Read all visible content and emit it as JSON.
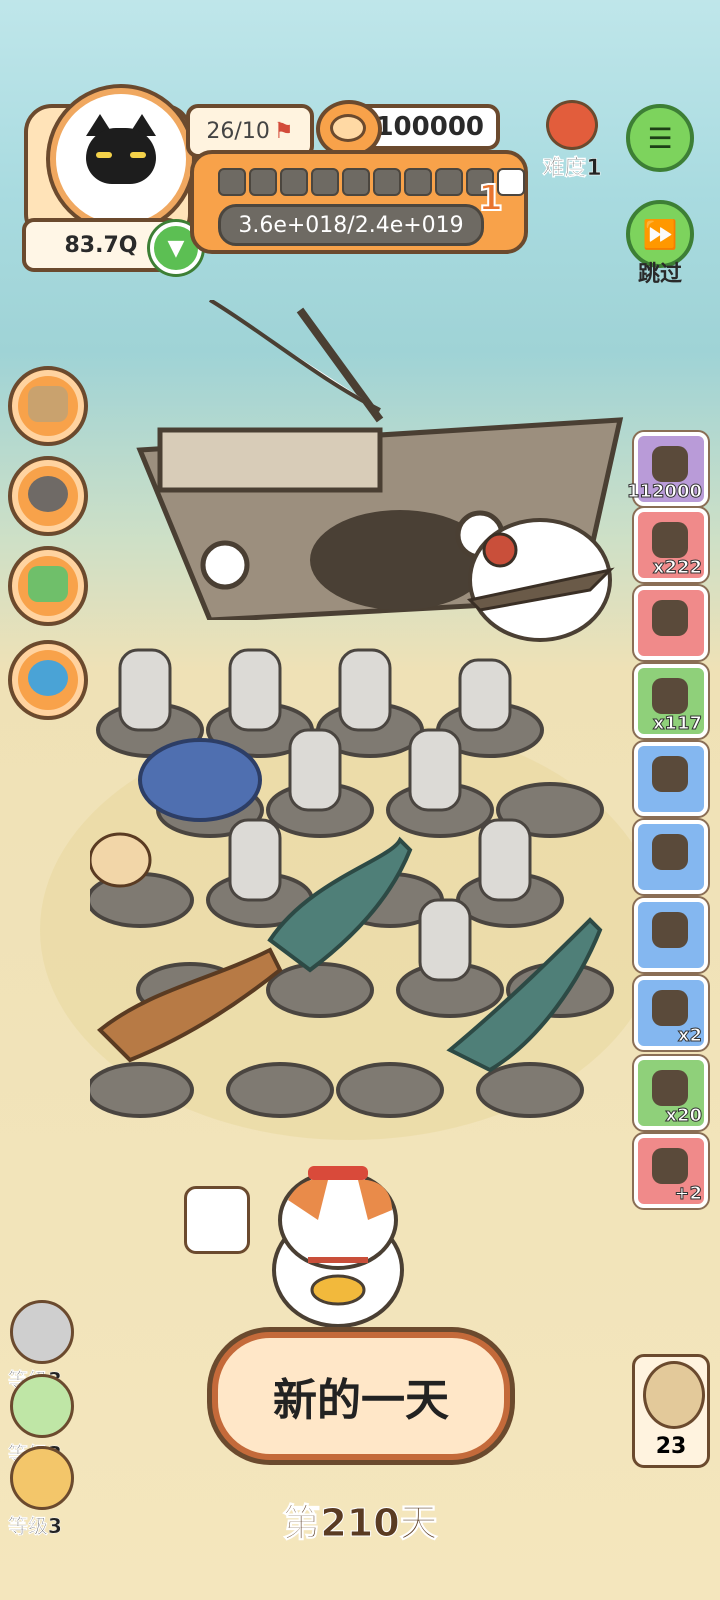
{
  "hud": {
    "power": "83.7Q",
    "stage_progress": "26/10",
    "coins": "100000",
    "xp_text": "3.6e+018/2.4e+019",
    "level": "1",
    "segments_filled": 9,
    "segments_total": 10,
    "difficulty_label": "难度1",
    "skip_label": "跳过"
  },
  "left_buttons": [
    {
      "icon": "box-icon"
    },
    {
      "icon": "food-bowl-icon"
    },
    {
      "icon": "handheld-console-icon"
    },
    {
      "icon": "joystick-icon"
    }
  ],
  "side_items": [
    {
      "icon": "cookie-icon",
      "count": "112000",
      "color": "#b99bd8"
    },
    {
      "icon": "bomb-icon",
      "count": "x222",
      "color": "#f08a8a"
    },
    {
      "icon": "fire-shield-icon",
      "count": "",
      "color": "#f08a8a"
    },
    {
      "icon": "sack-icon",
      "count": "x117",
      "color": "#8fd07a"
    },
    {
      "icon": "camera-icon",
      "count": "",
      "color": "#84b7f0"
    },
    {
      "icon": "sheep-icon",
      "count": "",
      "color": "#84b7f0"
    },
    {
      "icon": "hut-icon",
      "count": "",
      "color": "#84b7f0"
    },
    {
      "icon": "pot-icon",
      "count": "x2",
      "color": "#84b7f0"
    },
    {
      "icon": "helmet-icon",
      "count": "x20",
      "color": "#8fd07a"
    },
    {
      "icon": "coin-plus-icon",
      "count": "+2",
      "color": "#f08a8a"
    }
  ],
  "new_day_label": "新的一天",
  "day_label": "第210天",
  "levels": [
    {
      "label": "等级3",
      "color": "#cfcfcf"
    },
    {
      "label": "等级3",
      "color": "#bfe6a6"
    },
    {
      "label": "等级3",
      "color": "#f3c66a"
    }
  ],
  "friend_count": "23"
}
